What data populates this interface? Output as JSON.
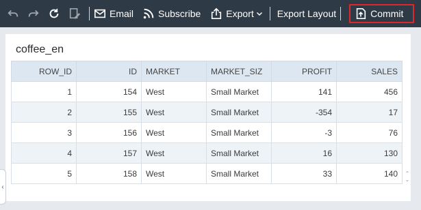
{
  "toolbar": {
    "undo_icon": "undo-icon",
    "redo_icon": "redo-icon",
    "refresh_icon": "refresh-icon",
    "edit_icon": "edit-icon",
    "email_label": "Email",
    "subscribe_label": "Subscribe",
    "export_label": "Export",
    "export_layout_label": "Export Layout",
    "commit_label": "Commit",
    "highlight_color": "#e0252b"
  },
  "table": {
    "title": "coffee_en",
    "columns": [
      "ROW_ID",
      "ID",
      "MARKET",
      "MARKET_SIZ",
      "PROFIT",
      "SALES"
    ],
    "rows": [
      [
        "1",
        "154",
        "West",
        "Small Market",
        "141",
        "456"
      ],
      [
        "2",
        "155",
        "West",
        "Small Market",
        "-354",
        "17"
      ],
      [
        "3",
        "156",
        "West",
        "Small Market",
        "-3",
        "76"
      ],
      [
        "4",
        "157",
        "West",
        "Small Market",
        "16",
        "130"
      ],
      [
        "5",
        "158",
        "West",
        "Small Market",
        "33",
        "140"
      ]
    ]
  },
  "side_handle": {
    "label": "‹"
  }
}
